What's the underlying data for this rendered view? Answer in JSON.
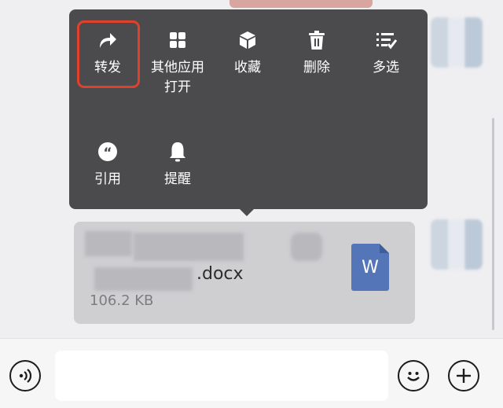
{
  "menu": {
    "items": [
      {
        "label": "转发",
        "icon": "forward-icon"
      },
      {
        "label": "其他应用\n打开",
        "icon": "other-apps-icon"
      },
      {
        "label": "收藏",
        "icon": "favorite-icon"
      },
      {
        "label": "删除",
        "icon": "delete-icon"
      },
      {
        "label": "多选",
        "icon": "multi-select-icon"
      },
      {
        "label": "引用",
        "icon": "quote-icon"
      },
      {
        "label": "提醒",
        "icon": "remind-bell-icon"
      }
    ],
    "highlight_color": "#e0412c"
  },
  "file": {
    "name_suffix": ".docx",
    "size": "106.2 KB",
    "type_letter": "W",
    "icon_color": "#5476b8"
  },
  "input_bar": {
    "voice_icon": "voice-icon",
    "emoji_icon": "emoji-icon",
    "plus_icon": "plus-icon"
  }
}
